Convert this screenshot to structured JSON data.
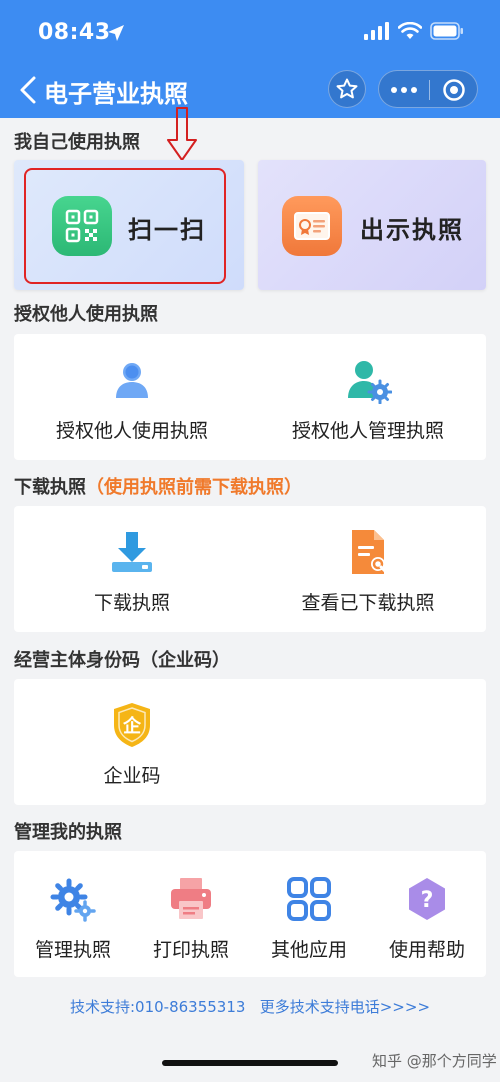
{
  "status_bar": {
    "time": "08:43"
  },
  "nav": {
    "title": "电子营业执照"
  },
  "sections": {
    "self": "我自己使用执照",
    "authorize": "授权他人使用执照",
    "download": "下载执照",
    "download_note": "（使用执照前需下载执照）",
    "identity": "经营主体身份码（企业码）",
    "manage": "管理我的执照"
  },
  "cards": {
    "scan": "扫一扫",
    "show": "出示执照"
  },
  "authorize_items": [
    "授权他人使用执照",
    "授权他人管理执照"
  ],
  "download_items": [
    "下载执照",
    "查看已下载执照"
  ],
  "identity_items": [
    "企业码"
  ],
  "manage_items": [
    "管理执照",
    "打印执照",
    "其他应用",
    "使用帮助"
  ],
  "icons": {
    "enterprise_glyph": "企",
    "help_glyph": "?"
  },
  "support": {
    "phone": "技术支持:010-86355313",
    "more": "更多技术支持电话>>>>"
  },
  "watermark": "知乎 @那个方同学",
  "colors": {
    "header": "#3d8cf2",
    "accent_orange": "#f07a2c",
    "highlight_red": "#e02424",
    "link_blue": "#3d7cd8"
  }
}
